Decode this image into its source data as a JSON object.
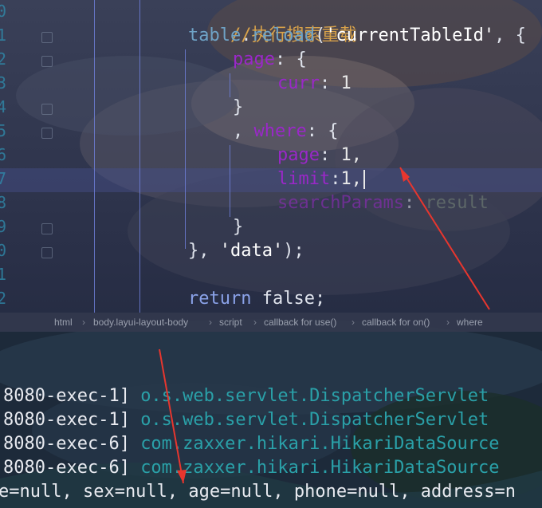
{
  "editor": {
    "line_numbers": [
      "0",
      "1",
      "2",
      "3",
      "4",
      "5",
      "6",
      "7",
      "8",
      "9",
      "0",
      "1",
      "2"
    ],
    "code": {
      "l1_comment": "//执行搜索重载",
      "l2_ident": "table",
      "l2_dot": ".",
      "l2_method": "reload",
      "l2_open": "(",
      "l2_str": "'currentTableId'",
      "l2_rest": ", {",
      "l3_prop": "page",
      "l3_rest": ": {",
      "l4_prop": "curr",
      "l4_colon": ": ",
      "l4_num": "1",
      "l5": "}",
      "l6_comma": ", ",
      "l6_prop": "where",
      "l6_rest": ": {",
      "l7_prop": "page",
      "l7_colon": ": ",
      "l7_num": "1,",
      "l8_prop": "limit",
      "l8_colon": ":",
      "l8_num": "1,",
      "l9_prop": "searchParams",
      "l9_colon": ": ",
      "l9_val": "result",
      "l10": "}",
      "l11_open": "}, ",
      "l11_str": "'data'",
      "l11_close": ");",
      "l13_kw": "return",
      "l13_val": " false;"
    }
  },
  "breadcrumb": [
    "html",
    "body.layui-layout-body",
    "script",
    "callback for use()",
    "callback for on()",
    "where"
  ],
  "console": {
    "lines": [
      {
        "thread": "8080-exec-1] ",
        "logger": "o.s.web.servlet.DispatcherServlet"
      },
      {
        "thread": "8080-exec-1] ",
        "logger": "o.s.web.servlet.DispatcherServlet"
      },
      {
        "thread": "8080-exec-6] ",
        "logger": "com.zaxxer.hikari.HikariDataSource"
      },
      {
        "thread": "8080-exec-6] ",
        "logger": "com.zaxxer.hikari.HikariDataSource"
      }
    ],
    "last_line": "e=null, sex=null, age=null, phone=null, address=n"
  },
  "colors": {
    "annotation_arrow": "#e8362e",
    "property": "#9a28c8",
    "comment": "#d8a24a",
    "logger": "#2aa0a8"
  }
}
